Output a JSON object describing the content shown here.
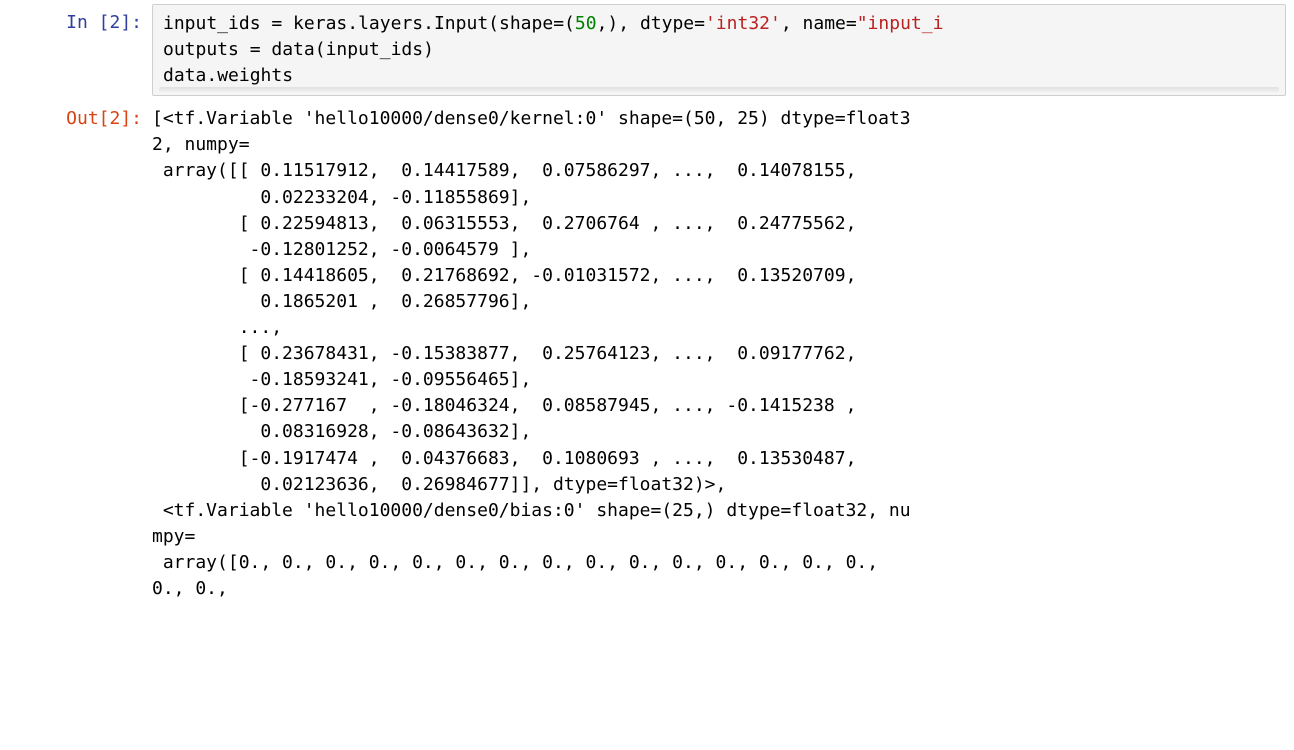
{
  "in_prompt": "In [2]:",
  "out_prompt": "Out[2]:",
  "code": {
    "l1": {
      "a": "input_ids ",
      "eq": "=",
      "b": " keras",
      "dot1": ".",
      "c": "layers",
      "dot2": ".",
      "d": "Input",
      "lp": "(",
      "kshape": "shape",
      "eq2": "=",
      "lpar": "(",
      "num50": "50",
      "comma1": ",",
      "rpar": ")",
      "comma2": ", ",
      "kdtype": "dtype",
      "eq3": "=",
      "sq1": "'int32'",
      "comma3": ", ",
      "kname": "name",
      "eq4": "=",
      "dq1": "\"input_i"
    },
    "l2": {
      "a": "outputs ",
      "eq": "=",
      "b": " data",
      "lp": "(",
      "c": "input_ids",
      "rp": ")"
    },
    "l3": {
      "a": "data",
      "dot": ".",
      "b": "weights"
    }
  },
  "output_lines": [
    "[<tf.Variable 'hello10000/dense0/kernel:0' shape=(50, 25) dtype=float3",
    "2, numpy=",
    " array([[ 0.11517912,  0.14417589,  0.07586297, ...,  0.14078155,",
    "          0.02233204, -0.11855869],",
    "        [ 0.22594813,  0.06315553,  0.2706764 , ...,  0.24775562,",
    "         -0.12801252, -0.0064579 ],",
    "        [ 0.14418605,  0.21768692, -0.01031572, ...,  0.13520709,",
    "          0.1865201 ,  0.26857796],",
    "        ...,",
    "        [ 0.23678431, -0.15383877,  0.25764123, ...,  0.09177762,",
    "         -0.18593241, -0.09556465],",
    "        [-0.277167  , -0.18046324,  0.08587945, ..., -0.1415238 ,",
    "          0.08316928, -0.08643632],",
    "        [-0.1917474 ,  0.04376683,  0.1080693 , ...,  0.13530487,",
    "          0.02123636,  0.26984677]], dtype=float32)>,",
    " <tf.Variable 'hello10000/dense0/bias:0' shape=(25,) dtype=float32, nu",
    "mpy=",
    " array([0., 0., 0., 0., 0., 0., 0., 0., 0., 0., 0., 0., 0., 0., 0.,",
    "0., 0.,"
  ],
  "watermark": ""
}
